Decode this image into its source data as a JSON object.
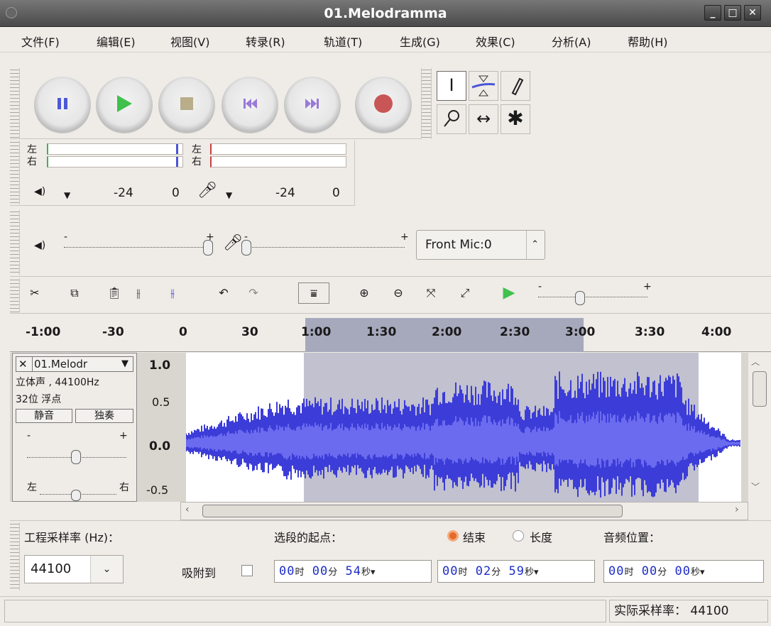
{
  "window": {
    "title": "01.Melodramma",
    "min": "_",
    "max": "□",
    "close": "✕"
  },
  "menu": [
    {
      "label": "文件(F)"
    },
    {
      "label": "编辑(E)"
    },
    {
      "label": "视图(V)"
    },
    {
      "label": "转录(R)"
    },
    {
      "label": "轨道(T)"
    },
    {
      "label": "生成(G)"
    },
    {
      "label": "效果(C)"
    },
    {
      "label": "分析(A)"
    },
    {
      "label": "帮助(H)"
    }
  ],
  "transport": {
    "pause": "pause-icon",
    "play": "play-icon",
    "stop": "stop-icon",
    "skip_start": "skip-to-start-icon",
    "skip_end": "skip-to-end-icon",
    "record": "record-icon"
  },
  "tools": {
    "select": "I",
    "envelope": "envelope-icon",
    "draw": "pencil-icon",
    "zoom": "zoom-icon",
    "timeshift": "↔",
    "multi": "✱"
  },
  "meters": {
    "left": "左",
    "right": "右",
    "play_ticks": [
      "-24",
      "0"
    ],
    "rec_ticks": [
      "-24",
      "0"
    ]
  },
  "mixer": {
    "minus": "-",
    "plus": "+",
    "input_device": "Front Mic:0",
    "input_arrow": "⌃⌄"
  },
  "edit_toolbar": {
    "minus": "-",
    "plus": "+"
  },
  "ruler": {
    "labels": [
      "-1:00",
      "-30",
      "0",
      "30",
      "1:00",
      "1:30",
      "2:00",
      "2:30",
      "3:00",
      "3:30",
      "4:00"
    ]
  },
  "track": {
    "name": "01.Melodr",
    "close": "✕",
    "dropdown": "▼",
    "info1": "立体声 , 44100Hz",
    "info2": "32位 浮点",
    "mute": "静音",
    "solo": "独奏",
    "gain_minus": "-",
    "gain_plus": "+",
    "pan_left": "左",
    "pan_right": "右",
    "yaxis": [
      "1.0",
      "0.5",
      "0.0",
      "-0.5"
    ]
  },
  "selection": {
    "project_rate_label": "工程采样率 (Hz)：",
    "project_rate": "44100",
    "start_label": "选段的起点：",
    "end_option": "结束",
    "length_option": "长度",
    "audio_position_label": "音频位置：",
    "snap_label": "吸附到",
    "start": {
      "h": "00",
      "m": "00",
      "s": "54"
    },
    "end": {
      "h": "00",
      "m": "02",
      "s": "59"
    },
    "pos": {
      "h": "00",
      "m": "00",
      "s": "00"
    },
    "unit_h": "时",
    "unit_m": "分",
    "unit_s": "秒"
  },
  "status": {
    "rate": "实际采样率： 44100"
  }
}
